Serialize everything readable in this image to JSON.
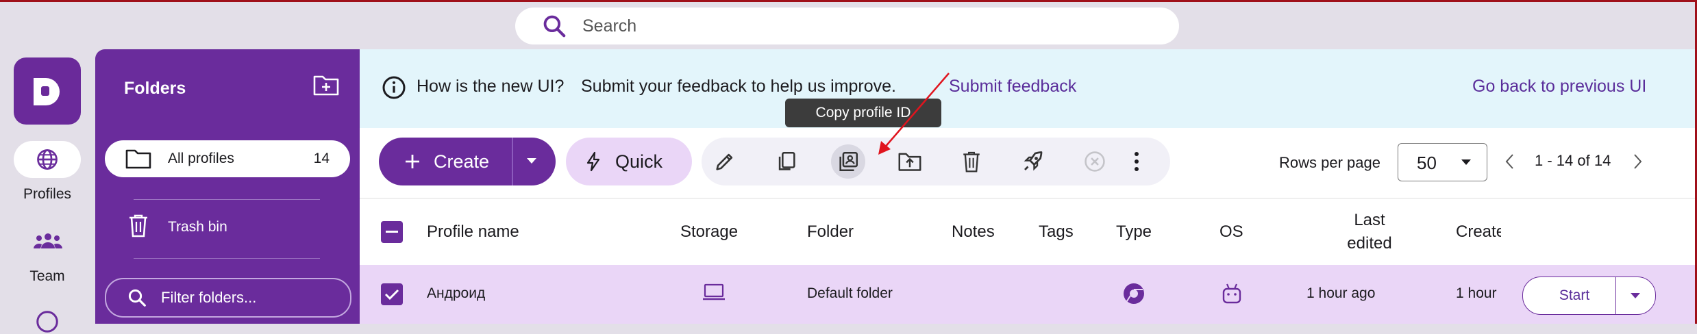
{
  "search": {
    "placeholder": "Search"
  },
  "rail": {
    "items": [
      {
        "label": "Profiles",
        "icon": "globe-icon",
        "active": true
      },
      {
        "label": "Team",
        "icon": "team-icon",
        "active": false
      }
    ]
  },
  "folders": {
    "title": "Folders",
    "items": [
      {
        "label": "All profiles",
        "count": "14",
        "icon": "folder-icon",
        "active": true
      },
      {
        "label": "Trash bin",
        "icon": "trash-icon",
        "active": false
      }
    ],
    "filter_placeholder": "Filter folders..."
  },
  "banner": {
    "question": "How is the new UI?",
    "message": "Submit your feedback to help us improve.",
    "feedback_link": "Submit feedback",
    "back_link": "Go back to previous UI"
  },
  "toolbar": {
    "create_label": "Create",
    "quick_label": "Quick",
    "tooltip": "Copy profile ID",
    "actions": [
      "edit-icon",
      "copy-icon",
      "copy-id-icon",
      "move-to-folder-icon",
      "delete-icon",
      "launch-icon",
      "stop-icon",
      "more-icon"
    ],
    "rows_per_page_label": "Rows per page",
    "rows_per_page_value": "50",
    "pagination": "1 - 14 of 14"
  },
  "table": {
    "columns": {
      "name": "Profile name",
      "storage": "Storage",
      "folder": "Folder",
      "notes": "Notes",
      "tags": "Tags",
      "type": "Type",
      "os": "OS",
      "last_edited_1": "Last",
      "last_edited_2": "edited",
      "created": "Create"
    },
    "rows": [
      {
        "name": "Андроид",
        "folder": "Default folder",
        "last_edited": "1 hour ago",
        "created": "1 hour",
        "start_label": "Start"
      }
    ]
  },
  "colors": {
    "primary": "#6a2c9c",
    "banner_bg": "#e3f5fb",
    "row_selected": "#ead6f7",
    "annotation_arrow": "#e0141e"
  }
}
